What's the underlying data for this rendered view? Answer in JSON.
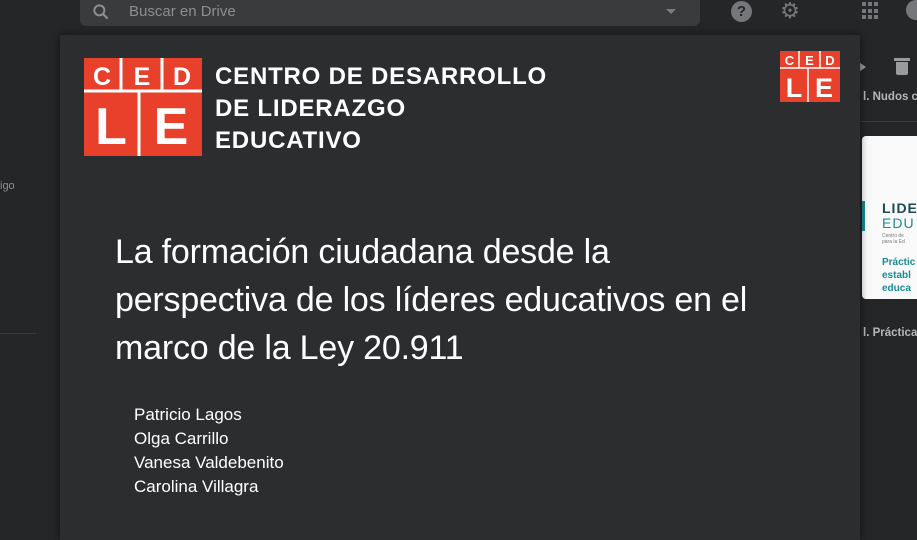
{
  "drive": {
    "search_placeholder": "Buscar en Drive",
    "side_label": "igo",
    "right_file_title": "l. Nudos c",
    "right_file_title2": "l. Práctica",
    "right_card": {
      "big_top": "LIDE",
      "big_bottom": "EDU",
      "tiny1": "Centro de",
      "tiny2": "para la Ed",
      "link1": "Práctic",
      "link2": "establ",
      "link3": "educa"
    },
    "icons": [
      "search-icon",
      "chevron-down-icon",
      "help-icon",
      "gear-icon",
      "apps-grid-icon",
      "account-icon",
      "play-icon",
      "trash-icon"
    ]
  },
  "slide": {
    "logo": {
      "letters_top": [
        "C",
        "E",
        "D"
      ],
      "letters_bottom": [
        "L",
        "E"
      ],
      "name_lines": [
        "CENTRO DE DESARROLLO",
        "DE LIDERAZGO",
        "EDUCATIVO"
      ]
    },
    "title_lines": [
      "La formación ciudadana desde la",
      "perspectiva de los líderes educativos en el",
      "marco de la Ley 20.911"
    ],
    "authors": [
      "Patricio Lagos",
      "Olga Carrillo",
      "Vanesa Valdebenito",
      "Carolina Villagra"
    ]
  },
  "colors": {
    "brand_red": "#e8402a",
    "slide_bg": "#2c2d2e",
    "page_bg": "#252627",
    "accent_teal": "#1a8a95"
  }
}
